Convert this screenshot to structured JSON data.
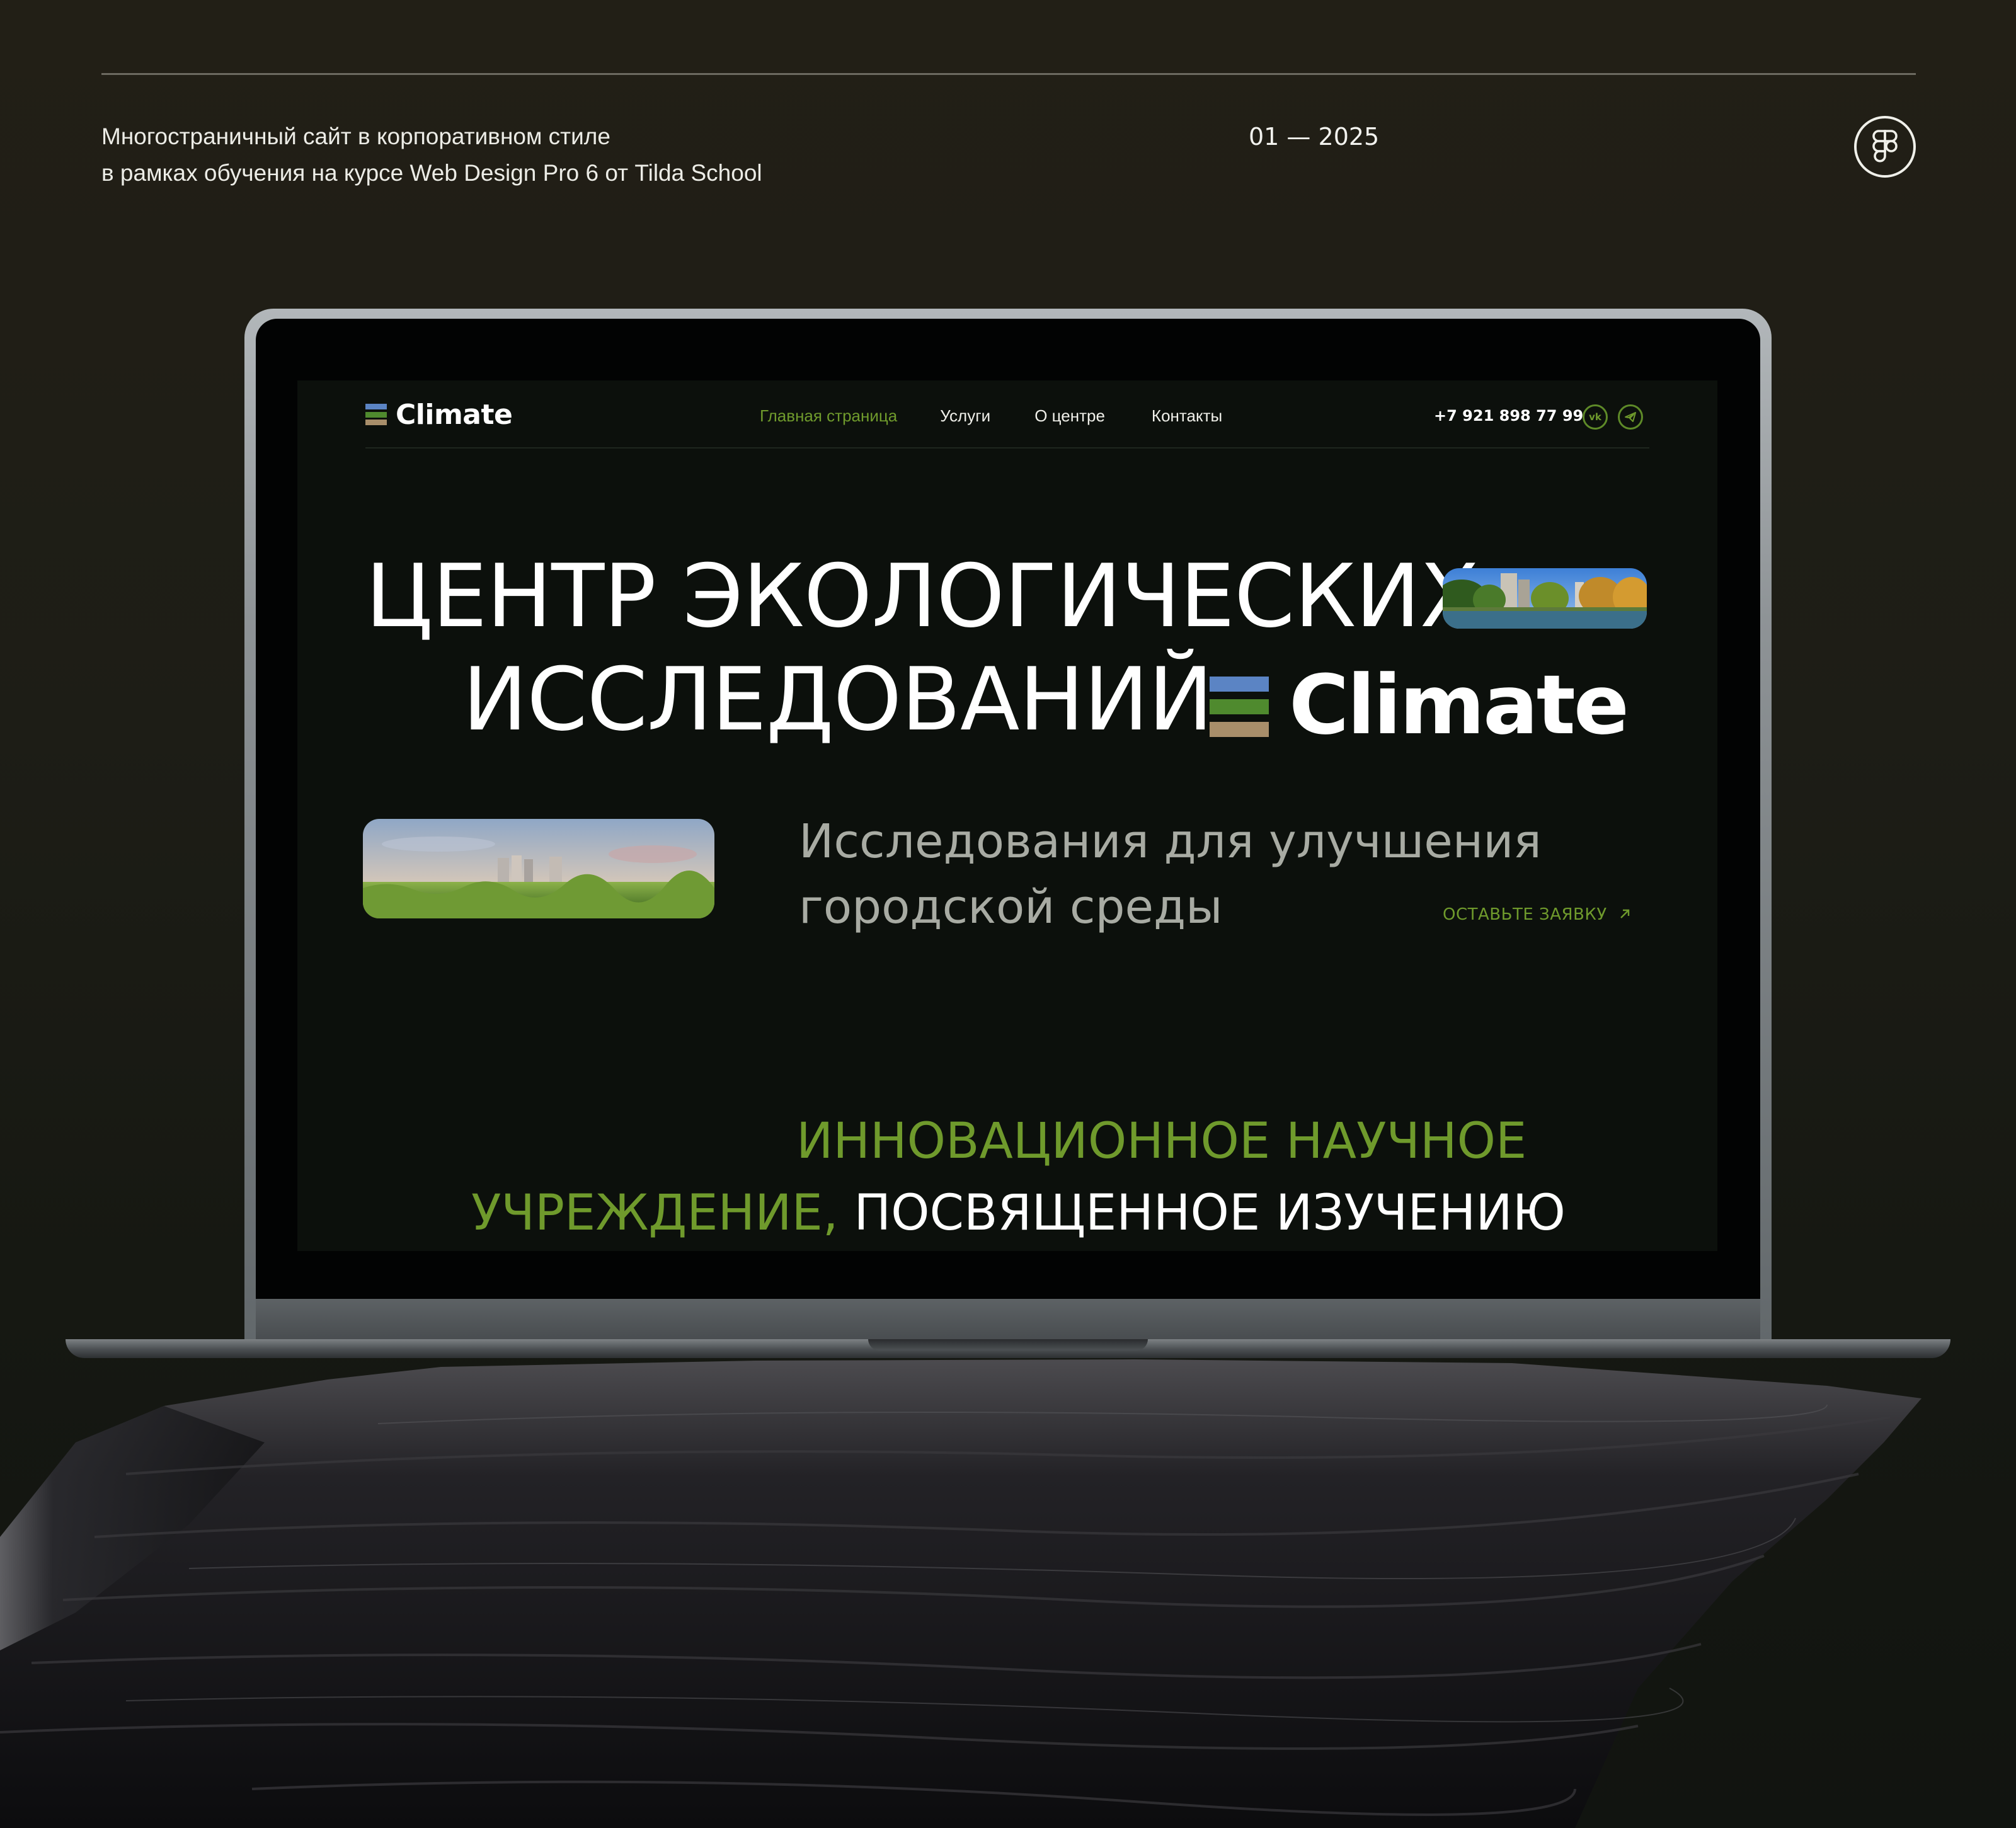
{
  "header": {
    "caption_line1": "Многостраничный сайт в корпоративном стиле",
    "caption_line2": "в рамках обучения на курсе Web Design Pro 6 от Tilda School",
    "date": "01 — 2025",
    "figma_icon": "figma-icon"
  },
  "site": {
    "logo_text": "Climate",
    "nav": [
      {
        "label": "Главная страница",
        "active": true
      },
      {
        "label": "Услуги",
        "active": false
      },
      {
        "label": "О центре",
        "active": false
      },
      {
        "label": "Контакты",
        "active": false
      }
    ],
    "phone": "+7 921 898 77 99",
    "social": [
      "vk-icon",
      "telegram-icon"
    ],
    "hero_line1": "ЦЕНТР ЭКОЛОГИЧЕСКИХ",
    "hero_line2": "ИССЛЕДОВАНИЙ",
    "brand_word": "Climate",
    "subtitle_line1": "Исследования для улучшения",
    "subtitle_line2": "городской среды",
    "cta": "ОСТАВЬТЕ ЗАЯВКУ",
    "cta_icon": "arrow-up-right-icon",
    "bottom_line1": "ИННОВАЦИОННОЕ НАУЧНОЕ",
    "bottom_line2_green": "УЧРЕЖДЕНИЕ,",
    "bottom_line2_white": "ПОСВЯЩЕННОЕ ИЗУЧЕНИЮ"
  },
  "colors": {
    "accent_green": "#6f9a2c",
    "logo_blue": "#5b84c4",
    "logo_green": "#4f8a2e",
    "logo_sand": "#a88e6a",
    "site_bg": "#0c100c",
    "page_bg": "#1d1d16"
  }
}
